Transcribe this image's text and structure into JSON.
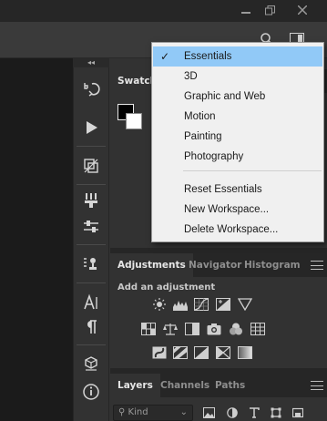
{
  "menu": {
    "items": [
      {
        "label": "Essentials",
        "checked": true
      },
      {
        "label": "3D"
      },
      {
        "label": "Graphic and Web"
      },
      {
        "label": "Motion"
      },
      {
        "label": "Painting"
      },
      {
        "label": "Photography"
      }
    ],
    "actions": [
      {
        "label": "Reset Essentials"
      },
      {
        "label": "New Workspace..."
      },
      {
        "label": "Delete Workspace..."
      }
    ],
    "check_glyph": "✓"
  },
  "panels": {
    "swatches_tab": "Swatches",
    "adjustment_tabs": [
      "Adjustments",
      "Navigator",
      "Histogram"
    ],
    "add_adjustment": "Add an adjustment",
    "layer_tabs": [
      "Layers",
      "Channels",
      "Paths"
    ],
    "kind_filter": "Kind"
  },
  "colors": {
    "menu_highlight": "#91c9f7",
    "foreground_swatch": "#000000",
    "background_swatch": "#ffffff"
  }
}
